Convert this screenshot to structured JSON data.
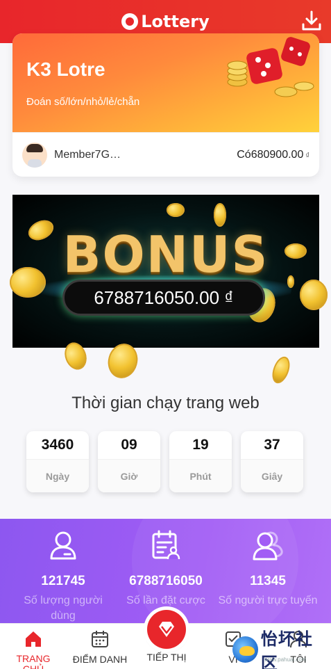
{
  "header": {
    "logo_text": "Lottery",
    "download_icon": "download-icon"
  },
  "game_card": {
    "title": "K3 Lotre",
    "subtitle": "Đoán số/lớn/nhỏ/lẻ/chẵn",
    "member_name": "Member7G…",
    "balance": "Có680900.00",
    "currency_symbol": "₫"
  },
  "bonus": {
    "word": "BONUS",
    "amount": "6788716050.00 ₫"
  },
  "uptime": {
    "title": "Thời gian chạy trang web",
    "counters": [
      {
        "value": "3460",
        "label": "Ngày"
      },
      {
        "value": "09",
        "label": "Giờ"
      },
      {
        "value": "19",
        "label": "Phút"
      },
      {
        "value": "37",
        "label": "Giây"
      }
    ]
  },
  "stats": [
    {
      "icon": "user-icon",
      "value": "121745",
      "label": "Số lượng người dùng"
    },
    {
      "icon": "calendar-user-icon",
      "value": "6788716050",
      "label": "Số lần đặt cược"
    },
    {
      "icon": "users-icon",
      "value": "11345",
      "label": "Số người trực tuyến"
    }
  ],
  "nav": [
    {
      "label": "TRANG CHỦ",
      "icon": "home-icon",
      "active": true
    },
    {
      "label": "ĐIỂM DANH",
      "icon": "calendar-icon",
      "active": false
    },
    {
      "label": "TIẾP THỊ",
      "icon": "gem-icon",
      "active": false
    },
    {
      "label": "VÍ",
      "icon": "wallet-icon",
      "active": false
    },
    {
      "label": "TÔI",
      "icon": "profile-icon",
      "active": false
    }
  ],
  "watermark": {
    "text": "怡坏社区",
    "sub": "www.pahuai.com"
  },
  "colors": {
    "brand_red": "#e8262b",
    "stats_purple": "#9b5bf3",
    "gold": "#f3c46a"
  }
}
